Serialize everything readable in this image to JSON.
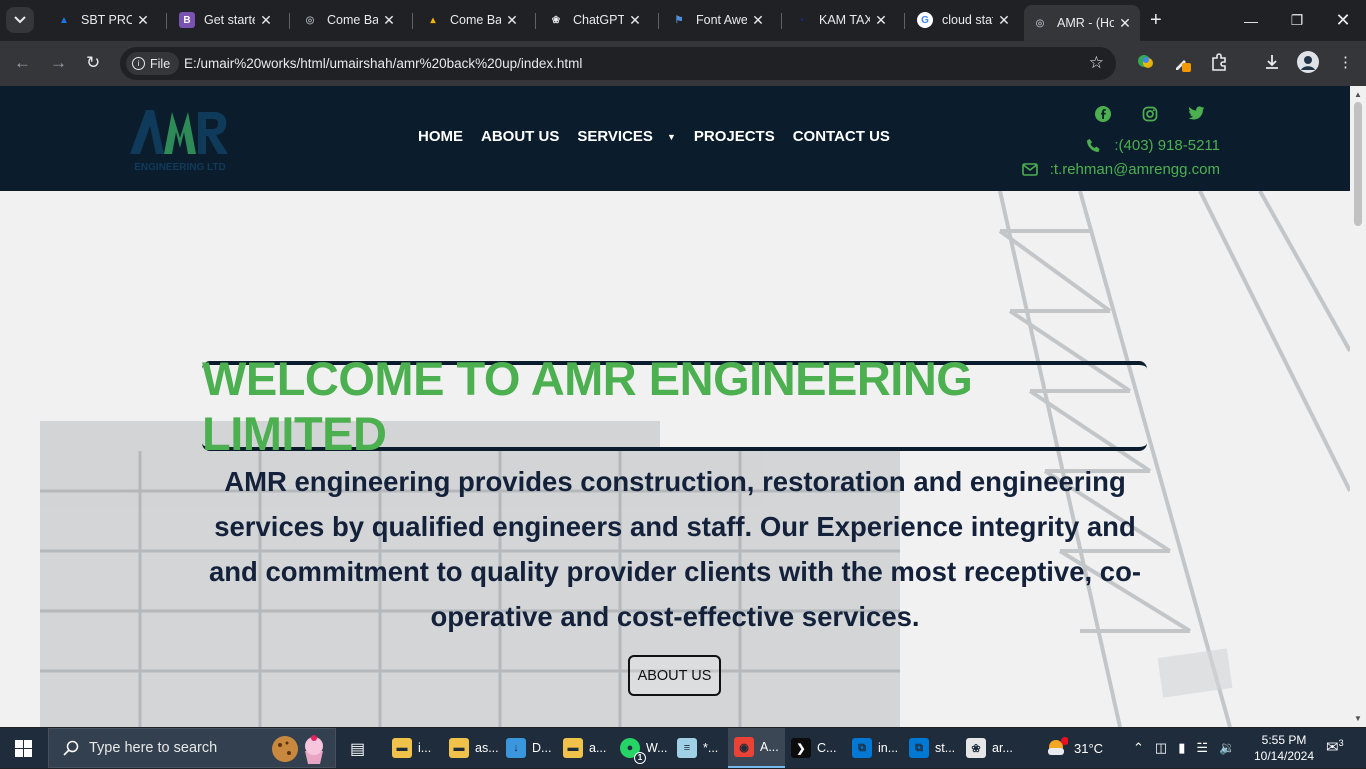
{
  "browser": {
    "tabs": [
      {
        "title": "SBT PROJE",
        "favicon": "drive-icon",
        "color": "#1a73e8"
      },
      {
        "title": "Get starte",
        "favicon": "bootstrap-icon",
        "color": "#7952b3"
      },
      {
        "title": "Come Bac",
        "favicon": "globe-icon",
        "color": "#9aa0a6"
      },
      {
        "title": "Come Bac",
        "favicon": "praying-hands-icon",
        "color": "#f5b400"
      },
      {
        "title": "ChatGPT",
        "favicon": "openai-icon",
        "color": "#e8eaed"
      },
      {
        "title": "Font Awe",
        "favicon": "flag-icon",
        "color": "#528dd7"
      },
      {
        "title": "KAM TAX",
        "favicon": "kam-icon",
        "color": "#1b2a6b"
      },
      {
        "title": "cloud staf",
        "favicon": "google-icon",
        "color": "#ffffff"
      },
      {
        "title": "AMR - (Ho",
        "favicon": "globe-icon",
        "color": "#9aa0a6",
        "active": true
      }
    ],
    "address": {
      "chip": "File",
      "url": "E:/umair%20works/html/umairshah/amr%20back%20up/index.html"
    }
  },
  "site": {
    "logo_text": "AMR",
    "logo_sub": "ENGINEERING LTD",
    "nav": [
      "HOME",
      "ABOUT US",
      "SERVICES",
      "PROJECTS",
      "CONTACT US"
    ],
    "social": [
      "facebook-icon",
      "instagram-icon",
      "twitter-icon"
    ],
    "phone": ":(403) 918-5211",
    "email": ":t.rehman@amrengg.com",
    "accent": "#4caf50",
    "header_bg": "#0b1d2c"
  },
  "hero": {
    "title": "WELCOME TO AMR ENGINEERING LIMITED",
    "intro_lines": [
      "AMR engineering provides construction, restoration and engineering",
      "services by qualified engineers and staff. Our Experience integrity and",
      "and commitment to quality provider clients with the most receptive, co-",
      "operative and cost-effective services."
    ],
    "button": "ABOUT US"
  },
  "taskbar": {
    "search_placeholder": "Type here to search",
    "apps": [
      "i...",
      "as...",
      "D...",
      "a...",
      "W...",
      "*...",
      "A...",
      "C...",
      "in...",
      "st...",
      "ar..."
    ],
    "whatsapp_badge": "1",
    "weather": "31°C",
    "weather_badge": "1",
    "time": "5:55 PM",
    "date": "10/14/2024",
    "notifications": "3"
  }
}
